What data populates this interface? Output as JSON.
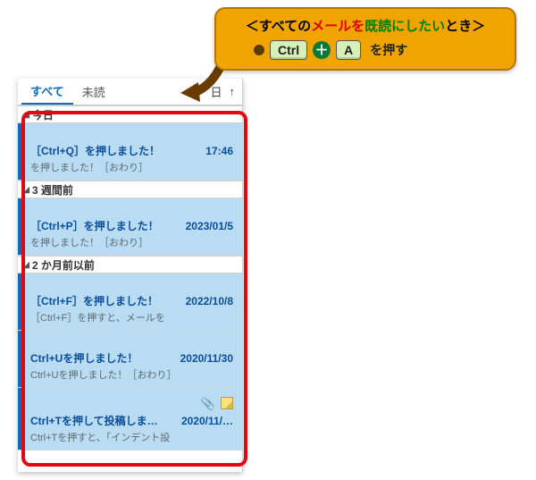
{
  "callout": {
    "prefix": "＜すべての",
    "mid_red": "メールを",
    "mid_green": "既読にしたい",
    "suffix": "とき＞",
    "key_ctrl": "Ctrl",
    "key_a": "A",
    "press_label": "を押す"
  },
  "tabs": {
    "all": "すべて",
    "unread": "未読",
    "date_label": "日",
    "sort_glyph": "↑"
  },
  "groups": [
    {
      "label": "今日"
    },
    {
      "label": "3 週間前"
    },
    {
      "label": "2 か月前以前"
    }
  ],
  "items": [
    {
      "subject": "［Ctrl+Q］を押しました！",
      "date": "17:46",
      "preview": "を押しました！［おわり］"
    },
    {
      "subject": "［Ctrl+P］を押しました！",
      "date": "2023/01/5",
      "preview": "を押しました！［おわり］"
    },
    {
      "subject": "［Ctrl+F］を押しました！",
      "date": "2022/10/8",
      "preview": "［Ctrl+F］を押すと、メールを"
    },
    {
      "subject": "Ctrl+Uを押しました！",
      "date": "2020/11/30",
      "preview": "Ctrl+Uを押しました！［おわり］"
    },
    {
      "subject": "Ctrl+Tを押して投稿します！",
      "date": "2020/11/…",
      "preview": "Ctrl+Tを押すと、「インデント設"
    }
  ]
}
